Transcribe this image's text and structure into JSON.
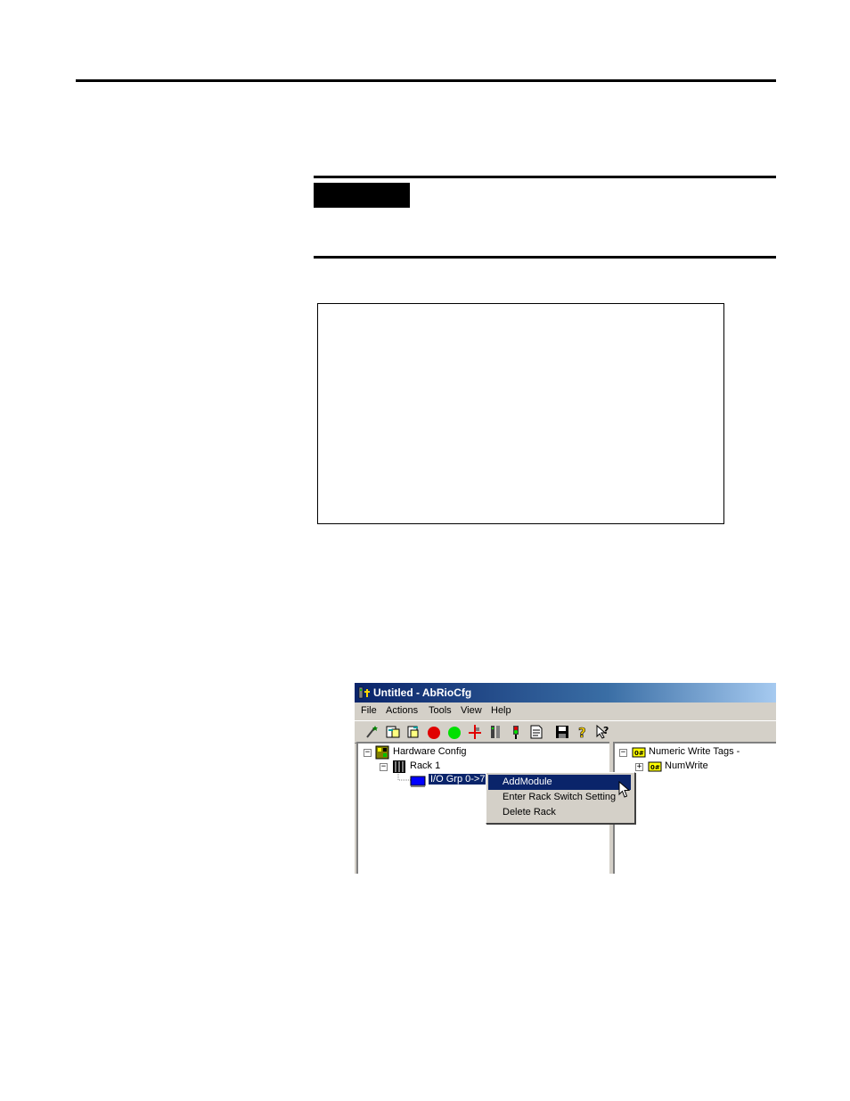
{
  "window": {
    "title": "Untitled - AbRioCfg"
  },
  "menu": {
    "items": [
      "File",
      "Actions",
      "Tools",
      "View",
      "Help"
    ]
  },
  "toolbar": {
    "icons": [
      "config-wand-icon",
      "upload-icon",
      "download-icon",
      "stop-red-icon",
      "run-green-icon",
      "network-icon",
      "io-rack-icon",
      "status-light-icon",
      "report-icon",
      "save-icon",
      "help-icon",
      "context-help-icon"
    ]
  },
  "tree": {
    "root": "Hardware Config",
    "rack": "Rack 1",
    "group": "I/O Grp 0->7"
  },
  "right_tree": {
    "root": "Numeric Write Tags -",
    "child": "NumWrite"
  },
  "context_menu": {
    "items": [
      "AddModule",
      "Enter Rack Switch Setting",
      "Delete Rack"
    ]
  },
  "colors": {
    "titlebar": "#0a246a",
    "selection": "#0a246a",
    "chrome": "#d4d0c8"
  }
}
